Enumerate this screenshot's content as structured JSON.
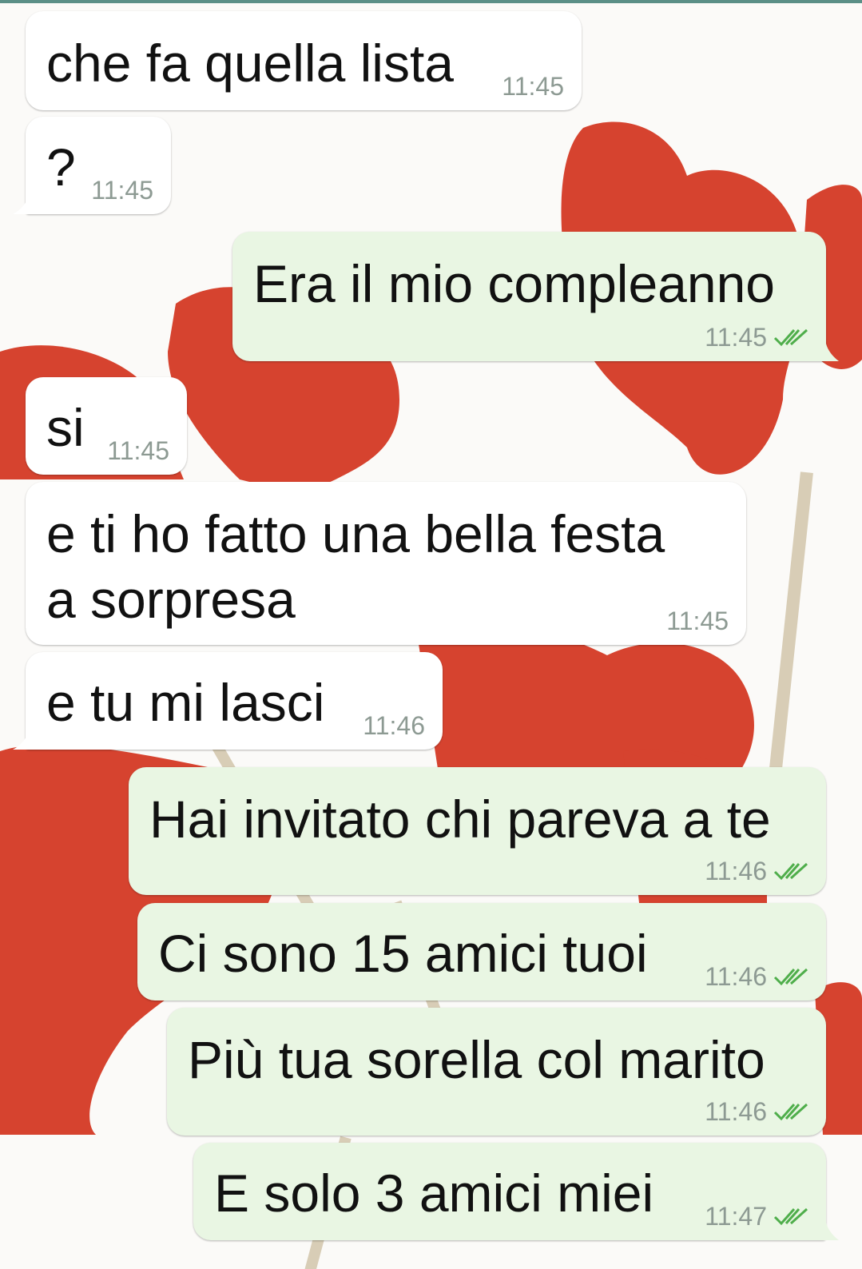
{
  "chat": {
    "messages": [
      {
        "direction": "in",
        "text": "che fa quella lista",
        "time": "11:45"
      },
      {
        "direction": "in",
        "text": "?",
        "time": "11:45"
      },
      {
        "direction": "out",
        "text": "Era il mio compleanno",
        "time": "11:45",
        "status": "read",
        "status_icon": "double-check-icon"
      },
      {
        "direction": "in",
        "text": "si",
        "time": "11:45"
      },
      {
        "direction": "in",
        "text_lines": [
          "e ti ho fatto una bella festa",
          "a sorpresa"
        ],
        "time": "11:45"
      },
      {
        "direction": "in",
        "text": "e tu mi lasci",
        "time": "11:46"
      },
      {
        "direction": "out",
        "text": "Hai invitato chi pareva a te",
        "time": "11:46",
        "status": "read",
        "status_icon": "double-check-icon"
      },
      {
        "direction": "out",
        "text": "Ci sono 15 amici tuoi",
        "time": "11:46",
        "status": "read",
        "status_icon": "double-check-icon"
      },
      {
        "direction": "out",
        "text": "Più tua sorella col marito",
        "time": "11:46",
        "status": "read",
        "status_icon": "double-check-icon"
      },
      {
        "direction": "out",
        "text": "E solo 3 amici miei",
        "time": "11:47",
        "status": "read",
        "status_icon": "double-check-icon"
      }
    ]
  },
  "colors": {
    "incoming_bubble": "#ffffff",
    "outgoing_bubble": "#e9f6e3",
    "timestamp": "#8d9a93",
    "read_ticks": "#4fae4b",
    "wallpaper_hearts": "#d6432f"
  },
  "wallpaper": {
    "motif": "red-heart-lollipops"
  }
}
